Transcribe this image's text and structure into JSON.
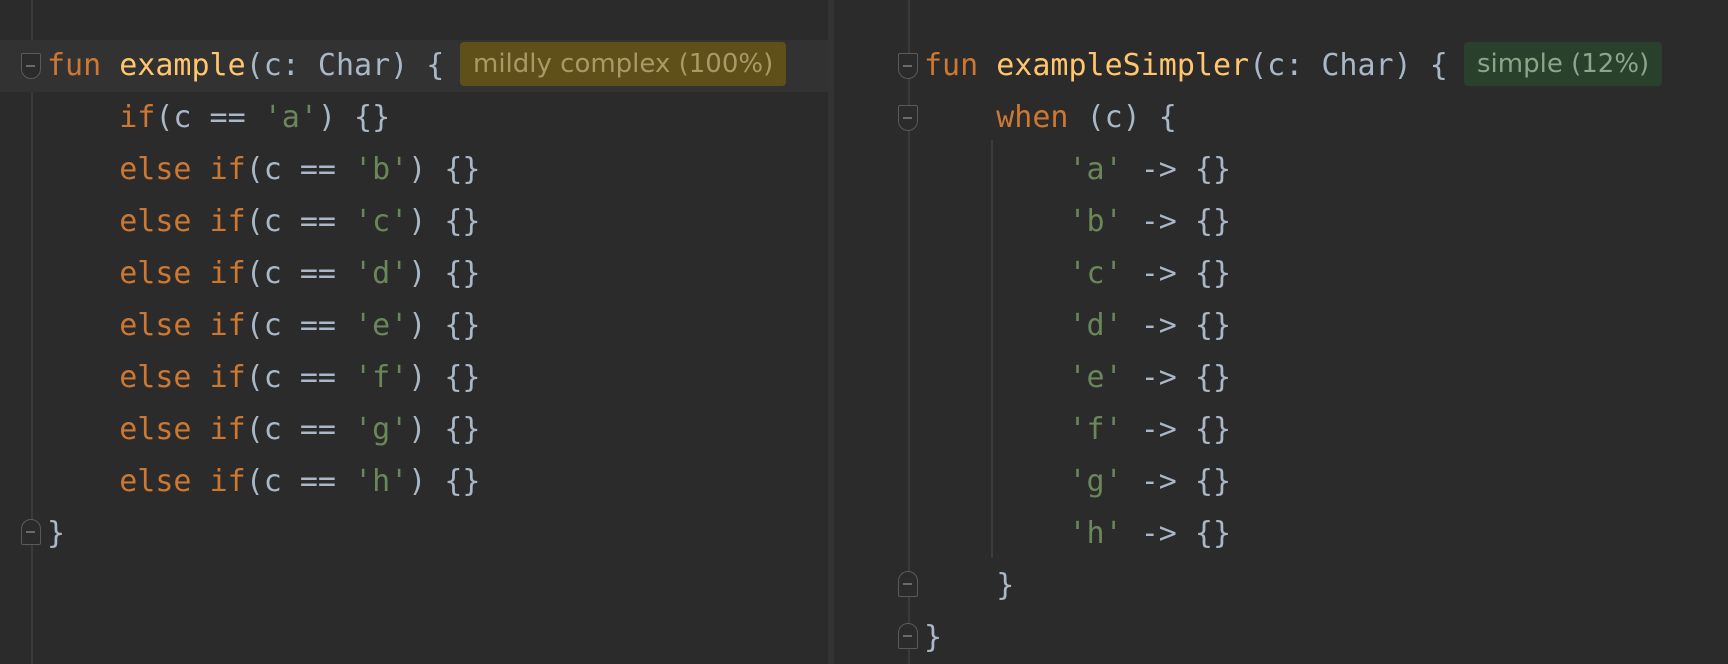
{
  "left_editor": {
    "hint": "mildly complex (100%)",
    "function_header": {
      "keyword": "fun",
      "name": "example",
      "params": "(c: Char) {"
    },
    "first_if": {
      "keyword": "if",
      "open": "(c == ",
      "char": "'a'",
      "close": ") {}"
    },
    "else_ifs": [
      {
        "else_kw": "else",
        "if_kw": "if",
        "open": "(c == ",
        "char": "'b'",
        "close": ") {}"
      },
      {
        "else_kw": "else",
        "if_kw": "if",
        "open": "(c == ",
        "char": "'c'",
        "close": ") {}"
      },
      {
        "else_kw": "else",
        "if_kw": "if",
        "open": "(c == ",
        "char": "'d'",
        "close": ") {}"
      },
      {
        "else_kw": "else",
        "if_kw": "if",
        "open": "(c == ",
        "char": "'e'",
        "close": ") {}"
      },
      {
        "else_kw": "else",
        "if_kw": "if",
        "open": "(c == ",
        "char": "'f'",
        "close": ") {}"
      },
      {
        "else_kw": "else",
        "if_kw": "if",
        "open": "(c == ",
        "char": "'g'",
        "close": ") {}"
      },
      {
        "else_kw": "else",
        "if_kw": "if",
        "open": "(c == ",
        "char": "'h'",
        "close": ") {}"
      }
    ],
    "closing_brace": "}"
  },
  "right_editor": {
    "hint": "simple (12%)",
    "function_header": {
      "keyword": "fun",
      "name": "exampleSimpler",
      "params": "(c: Char) {"
    },
    "when_line": {
      "keyword": "when",
      "rest": "(c) {"
    },
    "branches": [
      {
        "char": "'a'",
        "arrow": "-> {}"
      },
      {
        "char": "'b'",
        "arrow": "-> {}"
      },
      {
        "char": "'c'",
        "arrow": "-> {}"
      },
      {
        "char": "'d'",
        "arrow": "-> {}"
      },
      {
        "char": "'e'",
        "arrow": "-> {}"
      },
      {
        "char": "'f'",
        "arrow": "-> {}"
      },
      {
        "char": "'g'",
        "arrow": "-> {}"
      },
      {
        "char": "'h'",
        "arrow": "-> {}"
      }
    ],
    "when_closing": "}",
    "closing_brace": "}"
  },
  "colors": {
    "background": "#2b2b2b",
    "keyword": "#cc7832",
    "function_name": "#ffc66d",
    "string": "#6a8759",
    "text": "#a9b7c6",
    "hint_complex_bg": "#5f4f19",
    "hint_simple_bg": "#29402c"
  }
}
